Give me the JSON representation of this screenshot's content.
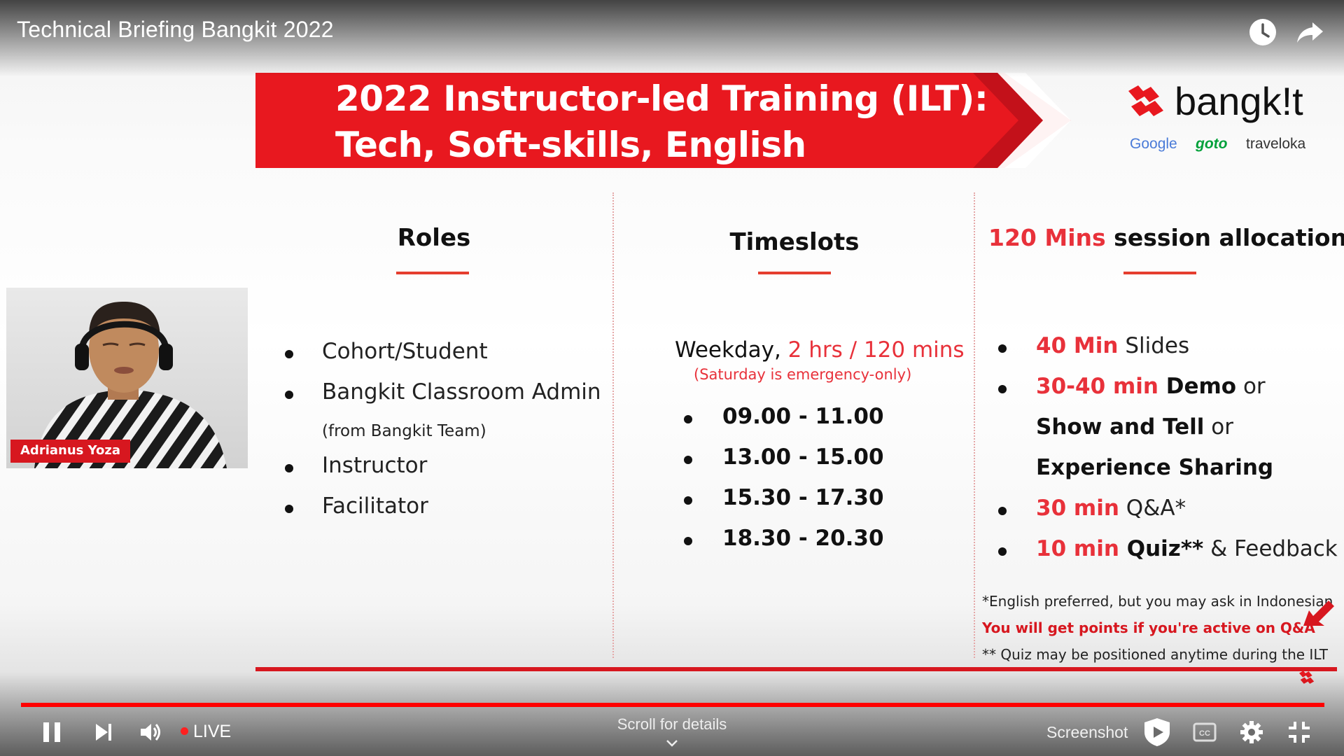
{
  "player": {
    "title": "Technical Briefing Bangkit 2022",
    "live_label": "LIVE",
    "scroll_hint": "Scroll for details",
    "screenshot_label": "Screenshot",
    "progress_color": "#ff0000"
  },
  "slide": {
    "banner": {
      "line1": "2022 Instructor-led Training (ILT):",
      "line2": "Tech, Soft-skills, English",
      "color": "#e8181f"
    },
    "logo": {
      "word": "bangk!t",
      "partners": [
        "Google",
        "goto",
        "traveloka"
      ]
    },
    "columns": {
      "roles": {
        "heading": "Roles",
        "items": [
          "Cohort/Student",
          "Bangkit Classroom Admin",
          "Instructor",
          "Facilitator"
        ],
        "sub_note": "(from Bangkit Team)"
      },
      "timeslots": {
        "heading": "Timeslots",
        "weekday_prefix": "Weekday,",
        "weekday_accent": "2 hrs / 120 mins",
        "saturday_note": "(Saturday is emergency-only)",
        "times": [
          "09.00 - 11.00",
          "13.00 - 15.00",
          "15.30 - 17.30",
          "18.30 - 20.30"
        ]
      },
      "allocation": {
        "heading_accent": "120 Mins",
        "heading_rest": "session allocation",
        "items": [
          {
            "red": "40 Min",
            "text": " Slides"
          },
          {
            "red": "30-40 min",
            "bold": " Demo",
            "text": " or"
          },
          {
            "bold": "Show and Tell",
            "text": " or"
          },
          {
            "bold": "Experience Sharing"
          },
          {
            "red": "30 min",
            "text": " Q&A*"
          },
          {
            "red": "10 min",
            "bold": " Quiz**",
            "text": " & Feedback"
          }
        ],
        "notes": [
          "*English preferred, but you may ask in Indonesian",
          "You will get points if you're active on Q&A",
          "** Quiz may be positioned anytime during the ILT"
        ]
      }
    }
  },
  "webcam": {
    "name": "Adrianus Yoza"
  },
  "colors": {
    "accent_red": "#e8313a",
    "brand_red": "#d7171f"
  }
}
